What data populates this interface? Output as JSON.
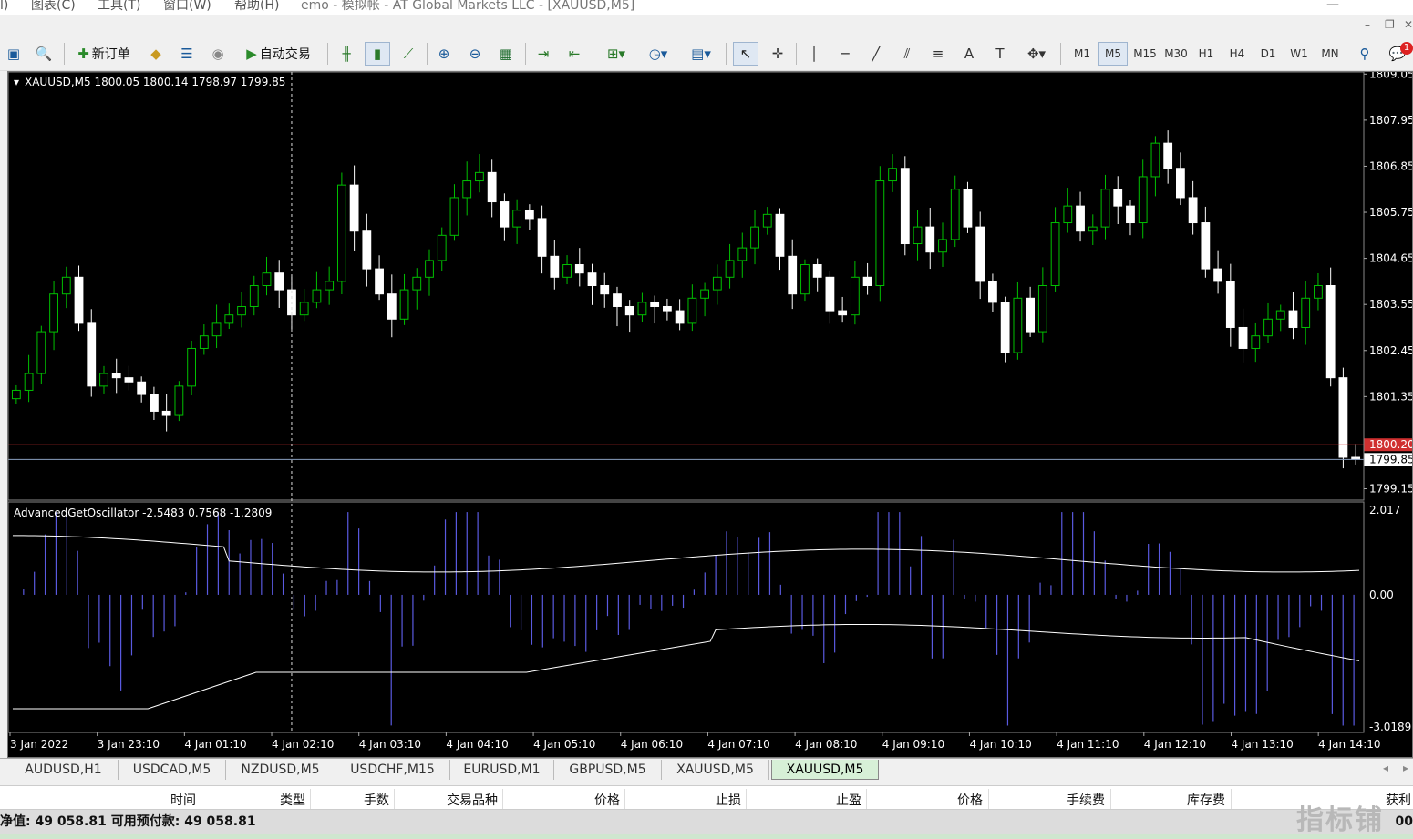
{
  "menu": {
    "left_fragment": "l)",
    "items": [
      "图表(C)",
      "工具(T)",
      "窗口(W)",
      "帮助(H)"
    ],
    "title_fragment": "emo - 模拟帐 - AT Global Markets LLC - [XAUUSD,M5]"
  },
  "toolbar": {
    "new_order_label": "新订单",
    "auto_trade_label": "自动交易",
    "timeframes": [
      "M1",
      "M5",
      "M15",
      "M30",
      "H1",
      "H4",
      "D1",
      "W1",
      "MN"
    ],
    "active_timeframe": "M5",
    "notification_count": "1"
  },
  "chart": {
    "info": "XAUUSD,M5  1800.05 1800.14 1798.97 1799.85",
    "indicator_info": "AdvancedGetOscillator -2.5483 0.7568 -1.2809",
    "bid_label": "1800.20",
    "current_label": "1799.85",
    "colors": {
      "bull": "#00c000",
      "bear": "#ffffff",
      "bid_line": "#d03030",
      "osc_bars": "#5a5ae0"
    }
  },
  "chart_data": {
    "type": "candlestick",
    "symbol": "XAUUSD",
    "timeframe": "M5",
    "price_ticks": [
      1809.05,
      1807.95,
      1806.85,
      1805.75,
      1804.65,
      1803.55,
      1802.45,
      1801.35,
      1800.2,
      1799.85,
      1799.15
    ],
    "price_tick_labels": [
      "1809.05",
      "1807.95",
      "1806.85",
      "1805.75",
      "1804.65",
      "1803.55",
      "1802.45",
      "1801.35",
      "1800.20",
      "1799.85",
      "1799.15"
    ],
    "price_range": [
      1798.9,
      1809.1
    ],
    "closes": [
      1801.5,
      1801.9,
      1802.9,
      1803.8,
      1804.2,
      1803.1,
      1801.6,
      1801.9,
      1801.8,
      1801.7,
      1801.4,
      1801.0,
      1800.9,
      1801.6,
      1802.5,
      1802.8,
      1803.1,
      1803.3,
      1803.5,
      1804.0,
      1804.3,
      1803.9,
      1803.3,
      1803.6,
      1803.9,
      1804.1,
      1806.4,
      1805.3,
      1804.4,
      1803.8,
      1803.2,
      1803.9,
      1804.2,
      1804.6,
      1805.2,
      1806.1,
      1806.5,
      1806.7,
      1806.0,
      1805.4,
      1805.8,
      1805.6,
      1804.7,
      1804.2,
      1804.5,
      1804.3,
      1804.0,
      1803.8,
      1803.5,
      1803.3,
      1803.6,
      1803.5,
      1803.4,
      1803.1,
      1803.7,
      1803.9,
      1804.2,
      1804.6,
      1804.9,
      1805.4,
      1805.7,
      1804.7,
      1803.8,
      1804.5,
      1804.2,
      1803.4,
      1803.3,
      1804.2,
      1804.0,
      1806.5,
      1806.8,
      1805.0,
      1805.4,
      1804.8,
      1805.1,
      1806.3,
      1805.4,
      1804.1,
      1803.6,
      1802.4,
      1803.7,
      1802.9,
      1804.0,
      1805.5,
      1805.9,
      1805.3,
      1805.4,
      1806.3,
      1805.9,
      1805.5,
      1806.6,
      1807.4,
      1806.8,
      1806.1,
      1805.5,
      1804.4,
      1804.1,
      1803.0,
      1802.5,
      1802.8,
      1803.2,
      1803.4,
      1803.0,
      1803.7,
      1804.0,
      1801.8,
      1799.9,
      1799.85
    ],
    "oscillator": {
      "name": "AdvancedGetOscillator",
      "values_text": [
        "-2.5483",
        "0.7568",
        "-1.2809"
      ],
      "range": [
        -3.0189,
        2.017
      ],
      "tick_labels": [
        "2.017",
        "0.00",
        "-3.0189"
      ]
    },
    "time_labels": [
      "3 Jan 2022",
      "3 Jan 23:10",
      "4 Jan 01:10",
      "4 Jan 02:10",
      "4 Jan 03:10",
      "4 Jan 04:10",
      "4 Jan 05:10",
      "4 Jan 06:10",
      "4 Jan 07:10",
      "4 Jan 08:10",
      "4 Jan 09:10",
      "4 Jan 10:10",
      "4 Jan 11:10",
      "4 Jan 12:10",
      "4 Jan 13:10",
      "4 Jan 14:10"
    ]
  },
  "tabs": {
    "items": [
      "AUDUSD,H1",
      "USDCAD,M5",
      "NZDUSD,M5",
      "USDCHF,M15",
      "EURUSD,M1",
      "GBPUSD,M5",
      "XAUUSD,M5",
      "XAUUSD,M5"
    ],
    "active_index": 7
  },
  "terminal": {
    "columns": [
      "时间",
      "类型",
      "手数",
      "交易品种",
      "价格",
      "止损",
      "止盈",
      "价格",
      "手续费",
      "库存费",
      "获利"
    ],
    "status_text": "净值: 49 058.81  可用预付款: 49 058.81",
    "status_right": "00"
  },
  "watermark": "指标铺"
}
